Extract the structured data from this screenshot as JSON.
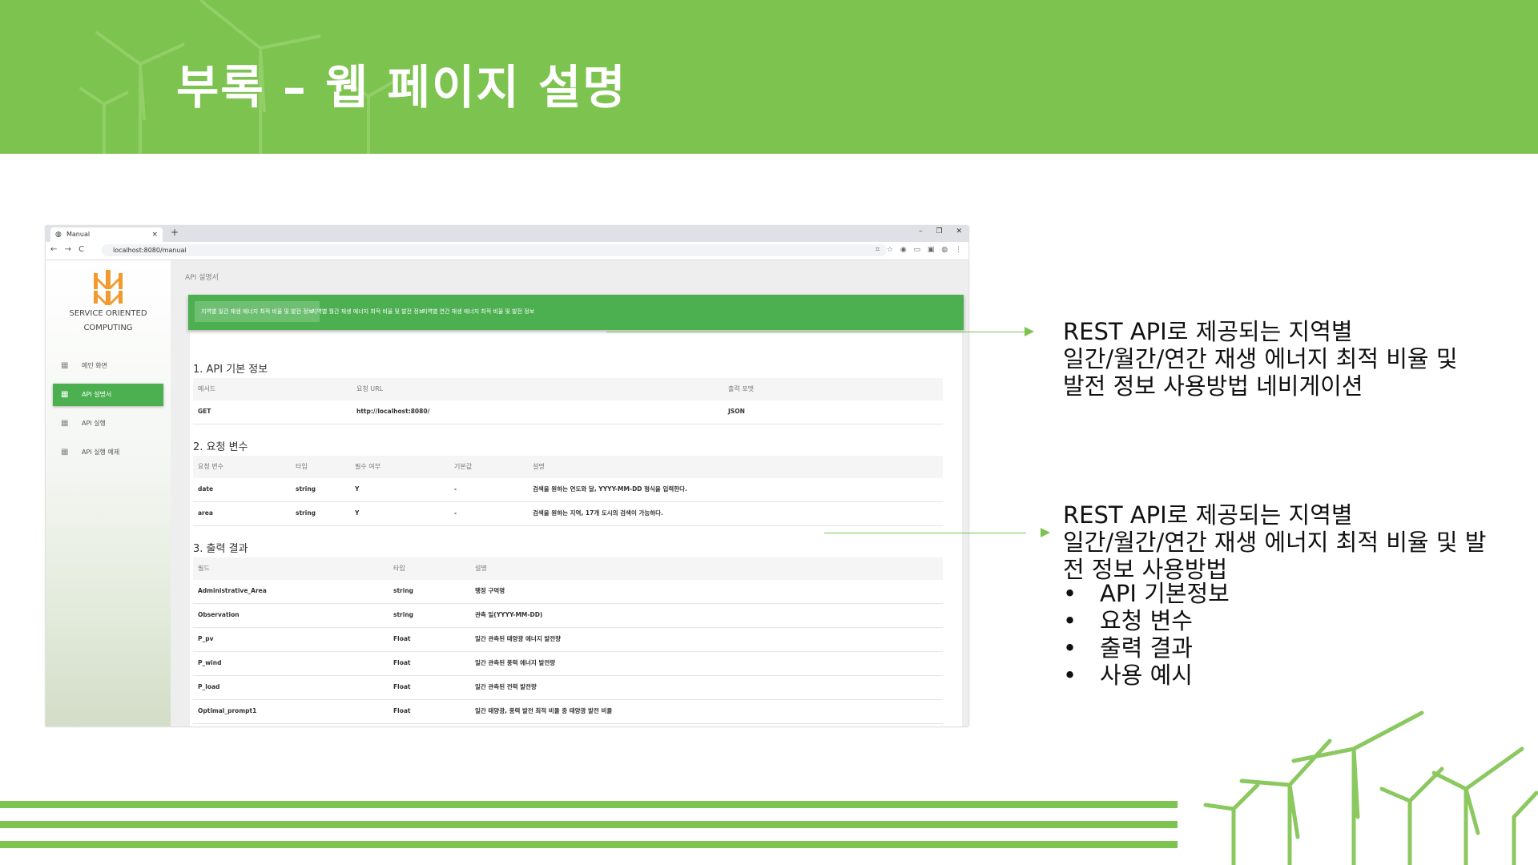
{
  "slide": {
    "title": "부록 – 웹 페이지 설명",
    "colors": {
      "accent": "#7dc34f",
      "menu_active": "#4caf50"
    }
  },
  "browser": {
    "tab_title": "Manual",
    "tab_close": "×",
    "new_tab": "+",
    "window_controls": "– ❐ ✕",
    "nav_buttons": "← → C",
    "url": "localhost:8080/manual",
    "extension_icons": "⌗ ☆ ◉ ▭ ▣ ◍ ⋮"
  },
  "sidebar": {
    "org_line1": "SERVICE ORIENTED",
    "org_line2": "COMPUTING",
    "items": [
      {
        "label": "메인 화면",
        "icon": "dashboard-icon",
        "active": false
      },
      {
        "label": "API 설명서",
        "icon": "dashboard-icon",
        "active": true
      },
      {
        "label": "API 실행",
        "icon": "dashboard-icon",
        "active": false
      },
      {
        "label": "API 실행 예제",
        "icon": "dashboard-icon",
        "active": false
      }
    ]
  },
  "main": {
    "breadcrumb": "API 설명서",
    "tabs": [
      {
        "label": "지역별 일간 재생 에너지 최적 비율 및 발전 정보",
        "active": true
      },
      {
        "label": "지역별 월간 재생 에너지 최적 비율 및 발전 정보",
        "active": false
      },
      {
        "label": "지역별 연간 재생 에너지 최적 비율 및 발전 정보",
        "active": false
      }
    ],
    "section1": {
      "title": "1. API 기본 정보",
      "headers": [
        "메서드",
        "요청 URL",
        "출력 포맷"
      ],
      "rows": [
        [
          "GET",
          "http://localhost:8080/",
          "JSON"
        ]
      ]
    },
    "section2": {
      "title": "2. 요청 변수",
      "headers": [
        "요청 변수",
        "타입",
        "필수 여부",
        "기본값",
        "설명"
      ],
      "rows": [
        [
          "date",
          "string",
          "Y",
          "-",
          "검색을 원하는 연도와 달, YYYY-MM-DD 형식을 입력한다."
        ],
        [
          "area",
          "string",
          "Y",
          "-",
          "검색을 원하는 지역, 17개 도시의 검색이 가능하다."
        ]
      ]
    },
    "section3": {
      "title": "3. 출력 결과",
      "headers": [
        "필드",
        "타입",
        "설명"
      ],
      "rows": [
        [
          "Administrative_Area",
          "string",
          "행정 구역명"
        ],
        [
          "Observation",
          "string",
          "관측 일(YYYY-MM-DD)"
        ],
        [
          "P_pv",
          "Float",
          "일간 관측된 태양광 에너지 발전량"
        ],
        [
          "P_wind",
          "Float",
          "일간 관측된 풍력 에너지 발전량"
        ],
        [
          "P_load",
          "Float",
          "일간 관측된 전력 발전량"
        ],
        [
          "Optimal_prompt1",
          "Float",
          "일간 태양광, 풍력 발전 최적 비율 중 태양광 발전 비율"
        ]
      ]
    }
  },
  "annotations": {
    "first": [
      "REST API로 제공되는 지역별",
      "일간/월간/연간 재생 에너지 최적 비율 및",
      "발전 정보 사용방법 네비게이션"
    ],
    "second": [
      "REST API로 제공되는 지역별",
      "일간/월간/연간 재생 에너지 최적 비율 및 발",
      "전 정보 사용방법"
    ],
    "bullet_marker": "•",
    "bullets": [
      "API 기본정보",
      "요청 변수",
      "출력 결과",
      "사용 예시"
    ]
  }
}
